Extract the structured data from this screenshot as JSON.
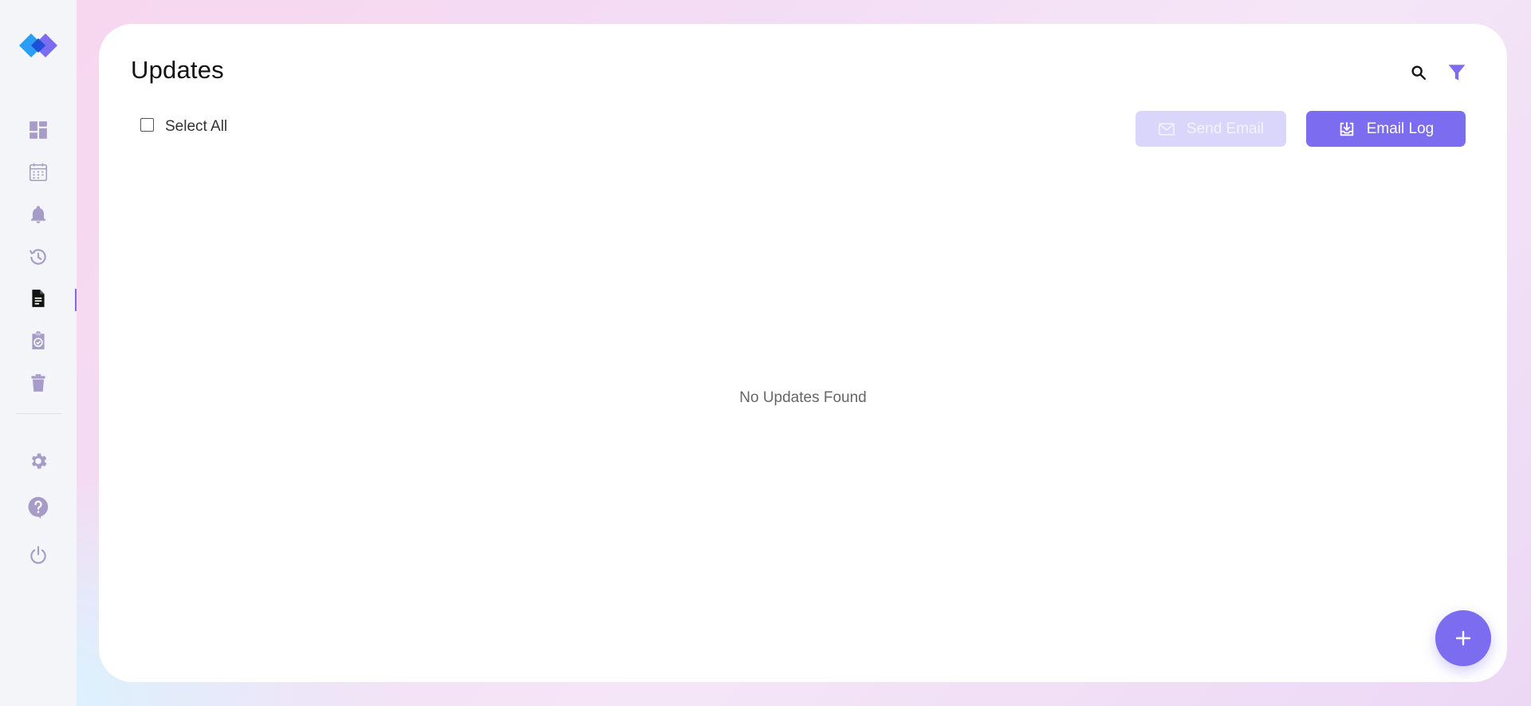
{
  "app": {
    "brand_color": "#7b6cf0"
  },
  "sidebar": {
    "items": [
      {
        "name": "dashboard",
        "icon": "dashboard-icon",
        "active": false
      },
      {
        "name": "calendar",
        "icon": "calendar-icon",
        "active": false
      },
      {
        "name": "notifications",
        "icon": "bell-icon",
        "active": false
      },
      {
        "name": "history",
        "icon": "history-icon",
        "active": false
      },
      {
        "name": "updates",
        "icon": "document-icon",
        "active": true
      },
      {
        "name": "tasks",
        "icon": "clipboard-check-icon",
        "active": false
      },
      {
        "name": "trash",
        "icon": "trash-icon",
        "active": false
      }
    ],
    "bottom_items": [
      {
        "name": "settings",
        "icon": "gear-icon"
      },
      {
        "name": "help",
        "icon": "help-icon"
      },
      {
        "name": "logout",
        "icon": "power-icon"
      }
    ]
  },
  "header": {
    "title": "Updates",
    "search_icon": "search-icon",
    "filter_icon": "filter-icon"
  },
  "toolbar": {
    "select_all_label": "Select All",
    "select_all_checked": false,
    "send_email_label": "Send Email",
    "send_email_enabled": false,
    "email_log_label": "Email Log"
  },
  "main": {
    "empty_message": "No Updates Found"
  },
  "fab": {
    "icon": "plus-icon"
  },
  "colors": {
    "accent": "#7b6cf0",
    "accent_disabled": "#dad6fb",
    "sidebar_icon": "#a79cc8"
  }
}
